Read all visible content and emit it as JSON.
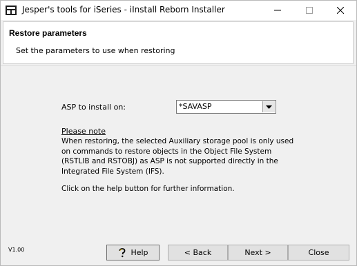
{
  "window": {
    "title": "Jesper's tools for iSeries - iInstall Reborn Installer",
    "icon": "installer-app-icon",
    "controls": [
      "minimize-icon",
      "maximize-icon",
      "close-icon"
    ]
  },
  "header": {
    "title": "Restore parameters",
    "subtitle": "Set the parameters to use when restoring"
  },
  "form": {
    "asp_label": "ASP to install on:",
    "asp_value": "*SAVASP"
  },
  "note": {
    "heading": "Please note",
    "body": "When restoring, the selected Auxiliary storage pool is only used on commands to restore objects in the Object File System (RSTLIB and RSTOBJ) as ASP is not supported directly in the Integrated File System (IFS).",
    "help_text": "Click on the help button for further information."
  },
  "footer": {
    "version": "V1.00",
    "help_label": "Help",
    "back_label": "< Back",
    "next_label": "Next >",
    "close_label": "Close"
  }
}
